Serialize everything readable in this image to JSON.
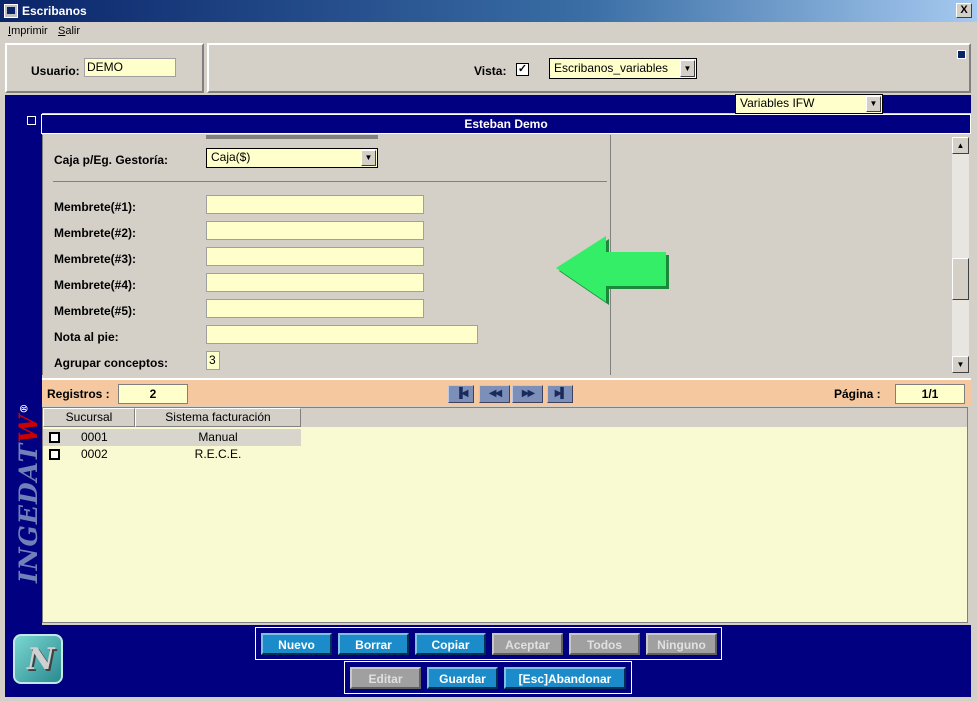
{
  "window": {
    "title": "Escribanos",
    "close_symbol": "X"
  },
  "menu": {
    "items": [
      "Imprimir",
      "Salir"
    ]
  },
  "header": {
    "usuario_label": "Usuario:",
    "usuario_value": "DEMO",
    "vista_label": "Vista:",
    "vista_checked": "✓",
    "vista_value": "Escribanos_variables",
    "secondary_view": "Variables IFW"
  },
  "section": {
    "title": "Esteban Demo"
  },
  "form": {
    "caja_label": "Caja p/Eg. Gestoría:",
    "caja_value": "Caja($)",
    "membrete1_label": "Membrete(#1):",
    "membrete2_label": "Membrete(#2):",
    "membrete3_label": "Membrete(#3):",
    "membrete4_label": "Membrete(#4):",
    "membrete5_label": "Membrete(#5):",
    "nota_label": "Nota al pie:",
    "agrupar_label": "Agrupar conceptos:",
    "agrupar_value": "3"
  },
  "registros": {
    "label": "Registros :",
    "count": "2",
    "pagina_label": "Página :",
    "pagina_value": "1/1"
  },
  "grid": {
    "columns": [
      "Sucursal",
      "Sistema facturación"
    ],
    "rows": [
      {
        "sucursal": "0001",
        "sistema": "Manual"
      },
      {
        "sucursal": "0002",
        "sistema": "R.E.C.E."
      }
    ]
  },
  "sideband": {
    "brand_main": "INGEDAT",
    "brand_accent": "W",
    "brand_mark": "®"
  },
  "buttons": {
    "nuevo": "Nuevo",
    "borrar": "Borrar",
    "copiar": "Copiar",
    "aceptar": "Aceptar",
    "todos": "Todos",
    "ninguno": "Ninguno",
    "editar": "Editar",
    "guardar": "Guardar",
    "abandonar": "[Esc]Abandonar"
  },
  "colors": {
    "navy": "#000080",
    "field_yellow": "#ffffcc",
    "button_blue": "#1b8cc9",
    "registros_bg": "#f5c8a0",
    "arrow_green": "#33ee66"
  }
}
